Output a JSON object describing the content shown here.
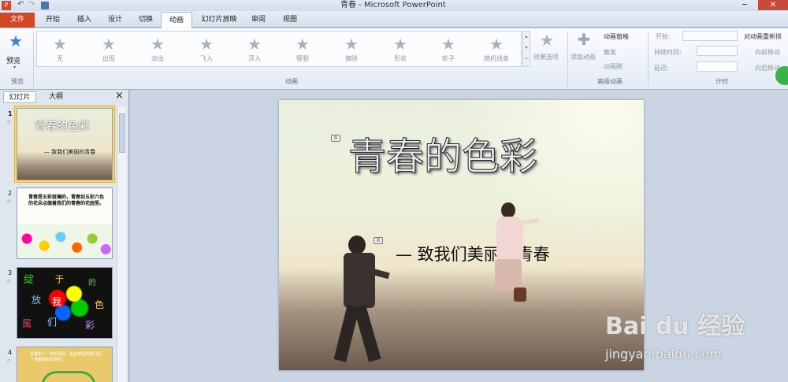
{
  "window": {
    "title": "青春 - Microsoft PowerPoint"
  },
  "tabs": [
    "文件",
    "开始",
    "插入",
    "设计",
    "切换",
    "动画",
    "幻灯片放映",
    "审阅",
    "视图"
  ],
  "active_tab": "动画",
  "ribbon": {
    "preview": {
      "label": "预览",
      "group": "预览"
    },
    "effects": [
      "无",
      "出现",
      "淡出",
      "飞入",
      "浮入",
      "劈裂",
      "擦除",
      "形状",
      "轮子",
      "随机线条"
    ],
    "effect_options": "效果选项",
    "animation_group": "动画",
    "add_animation": "添加动画",
    "animation_pane": "动画窗格",
    "trigger": "触发",
    "animation_painter": "动画刷",
    "advanced_group": "高级动画",
    "start": "开始:",
    "duration": "持续时间:",
    "delay": "延迟:",
    "timing_group": "计时",
    "reorder": "对动画重新排",
    "move_earlier": "向前移动",
    "move_later": "向后移动"
  },
  "panel": {
    "tab_slides": "幻灯片",
    "tab_outline": "大纲",
    "close": "×"
  },
  "thumbnails": [
    {
      "num": "1",
      "title": "青春的色彩",
      "subtitle": "— 致我们美丽的青春"
    },
    {
      "num": "2",
      "text": "青春是五彩斑斓的，青春如五彩六色的花朵点缀着我们的青春的花园里。"
    },
    {
      "num": "3",
      "chars": [
        "绽",
        "于",
        "放",
        "我",
        "色",
        "属",
        "们",
        "彩",
        "的"
      ]
    },
    {
      "num": "4",
      "text": "青春年少，无所顾忌，永远年轻的我们是一道靓丽的风景线。"
    }
  ],
  "slide": {
    "title": "青春的色彩",
    "subtitle": "— 致我们美丽的青春",
    "anim_tag_1": "0",
    "anim_tag_2": "0"
  },
  "watermark": {
    "brand": "Bai du 经验",
    "url": "jingyan.baidu.com"
  }
}
